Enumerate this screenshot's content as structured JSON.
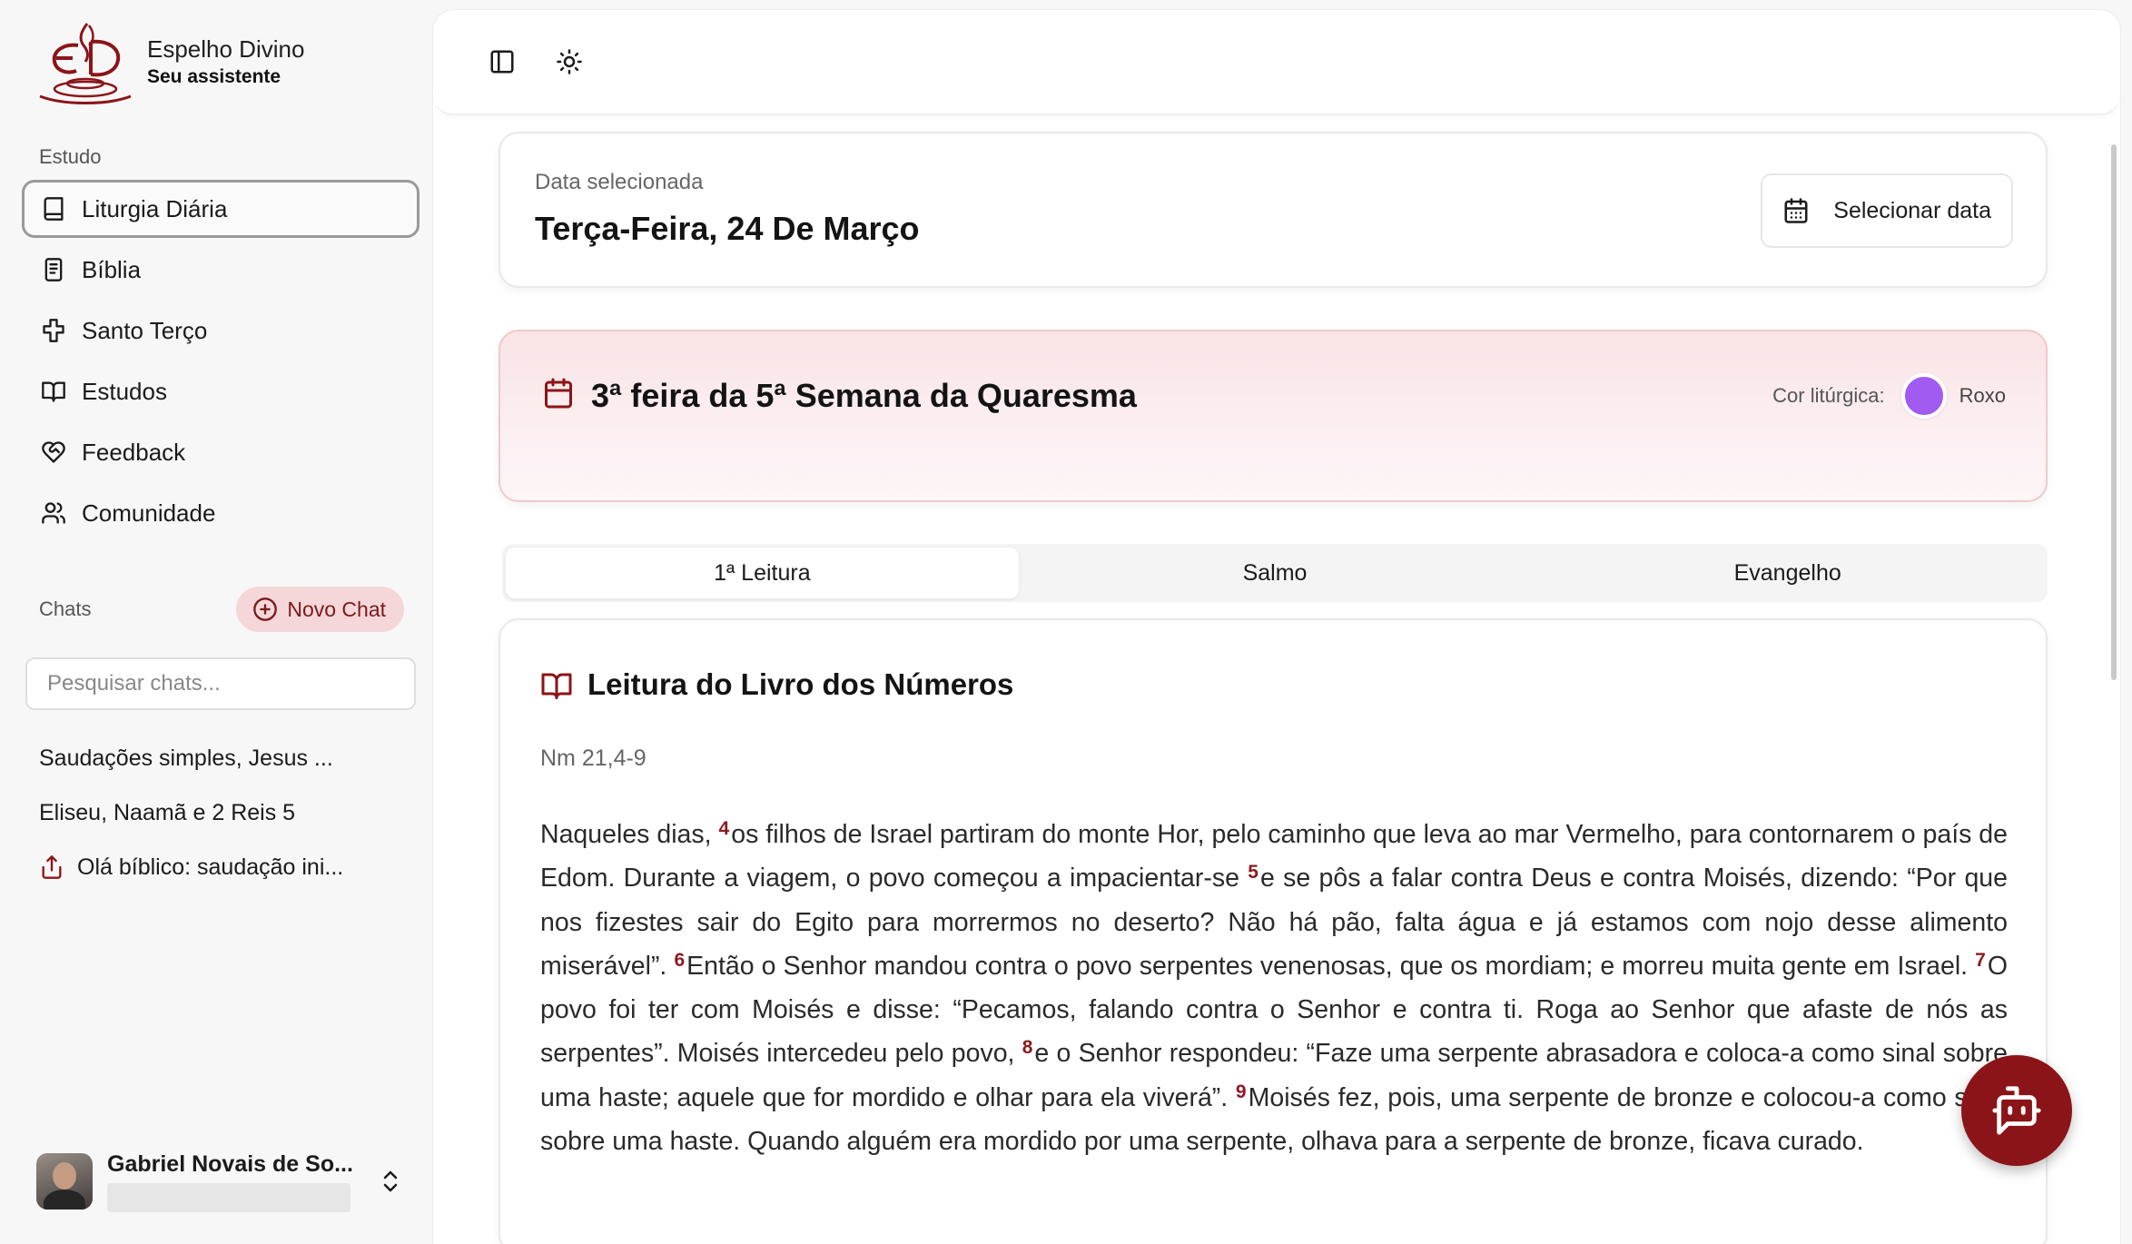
{
  "brand": {
    "name": "Espelho Divino",
    "subtitle": "Seu assistente"
  },
  "sidebar": {
    "section_label": "Estudo",
    "items": [
      {
        "label": "Liturgia Diária",
        "icon": "book-icon",
        "active": true
      },
      {
        "label": "Bíblia",
        "icon": "bible-icon",
        "active": false
      },
      {
        "label": "Santo Terço",
        "icon": "cross-icon",
        "active": false
      },
      {
        "label": "Estudos",
        "icon": "open-book-icon",
        "active": false
      },
      {
        "label": "Feedback",
        "icon": "heart-handshake-icon",
        "active": false
      },
      {
        "label": "Comunidade",
        "icon": "users-icon",
        "active": false
      }
    ],
    "chats_label": "Chats",
    "new_chat_label": "Novo Chat",
    "search_placeholder": "Pesquisar chats...",
    "chats": [
      {
        "title": "Saudações simples, Jesus ..."
      },
      {
        "title": "Eliseu, Naamã e 2 Reis 5"
      },
      {
        "title": "Olá bíblico: saudação ini...",
        "icon": "share-icon"
      }
    ],
    "user": {
      "name": "Gabriel Novais de So..."
    }
  },
  "date_card": {
    "label": "Data selecionada",
    "value": "Terça-Feira, 24 De Março",
    "button_label": "Selecionar data"
  },
  "liturgy": {
    "title": "3ª feira da 5ª Semana da Quaresma",
    "color_label": "Cor litúrgica:",
    "color_name": "Roxo",
    "color_hex": "#a15bf0"
  },
  "tabs": [
    "1ª Leitura",
    "Salmo",
    "Evangelho"
  ],
  "reading": {
    "title": "Leitura do Livro dos Números",
    "reference": "Nm 21,4-9",
    "segments": [
      {
        "verse": "",
        "text": "Naqueles dias, "
      },
      {
        "verse": "4",
        "text": "os filhos de Israel partiram do monte Hor, pelo caminho que leva ao mar Vermelho, para contornarem o país de Edom. Durante a viagem, o povo começou a impacientar-se "
      },
      {
        "verse": "5",
        "text": "e se pôs a falar contra Deus e contra Moisés, dizendo: “Por que nos fizestes sair do Egito para morrermos no deserto? Não há pão, falta água e já estamos com nojo desse alimento miserável”. "
      },
      {
        "verse": "6",
        "text": "Então o Senhor mandou contra o povo serpentes venenosas, que os mordiam; e morreu muita gente em Israel. "
      },
      {
        "verse": "7",
        "text": "O povo foi ter com Moisés e disse: “Pecamos, falando contra o Senhor e contra ti. Roga ao Senhor que afaste de nós as serpentes”. Moisés intercedeu pelo povo, "
      },
      {
        "verse": "8",
        "text": "e o Senhor respondeu: “Faze uma serpente abrasadora e coloca-a como sinal sobre uma haste; aquele que for mordido e olhar para ela viverá”. "
      },
      {
        "verse": "9",
        "text": "Moisés fez, pois, uma serpente de bronze e colocou-a como sinal sobre uma haste. Quando alguém era mordido por uma serpente, olhava para a serpente de bronze, ficava curado."
      }
    ]
  },
  "colors": {
    "accent": "#8b1418",
    "accent_soft": "#f6d7d9",
    "verse_number": "#8b1a1f"
  }
}
